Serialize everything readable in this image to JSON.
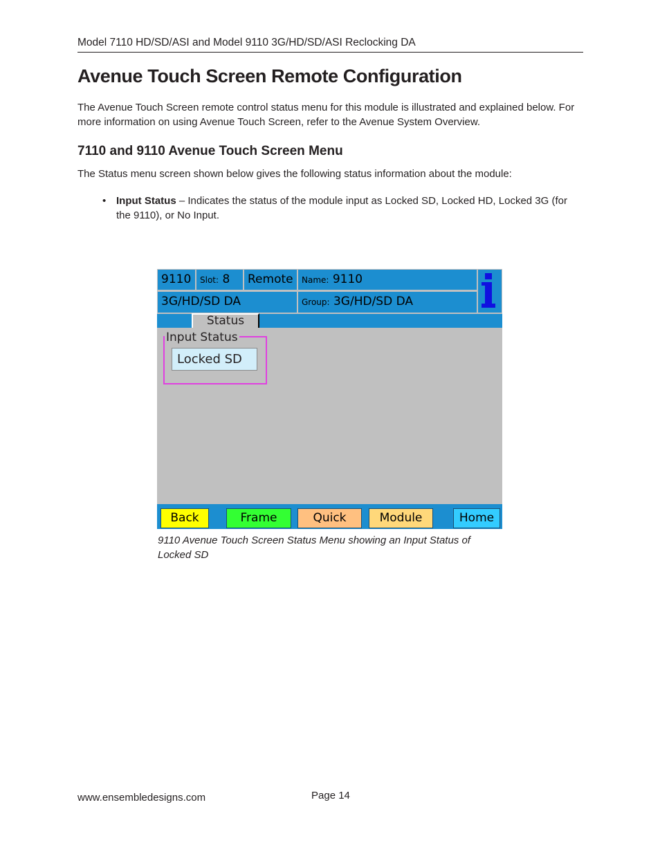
{
  "header": {
    "running_title": "Model 7110 HD/SD/ASI and Model 9110 3G/HD/SD/ASI Reclocking DA"
  },
  "title": "Avenue Touch Screen Remote Configuration",
  "intro": "The Avenue Touch Screen remote control status menu for this module is illustrated and explained below. For more information on using Avenue Touch Screen, refer to the Avenue System Overview.",
  "section": {
    "heading": "7110 and 9110 Avenue Touch Screen Menu",
    "text": "The Status menu screen shown below gives the following status information about the module:",
    "bullets": [
      {
        "term": "Input Status",
        "text": " – Indicates the status of the module input as Locked SD, Locked HD, Locked 3G (for the 9110), or No Input."
      }
    ]
  },
  "screen": {
    "model": "9110",
    "slot_label": "Slot:",
    "slot": "8",
    "mode": "Remote",
    "name_label": "Name:",
    "name": "9110",
    "type": "3G/HD/SD DA",
    "group_label": "Group:",
    "group": "3G/HD/SD DA",
    "info_icon": "info-icon",
    "tab": "Status",
    "input_status_label": "Input Status",
    "input_status_value": "Locked SD",
    "nav": [
      {
        "label": "Back",
        "color": "#ffff00"
      },
      {
        "label": "Frame",
        "color": "#33ff33"
      },
      {
        "label": "Quick",
        "color": "#ffc080"
      },
      {
        "label": "Module",
        "color": "#ffd87a"
      },
      {
        "label": "Home",
        "color": "#33ccff"
      }
    ],
    "accent_color": "#1c8ed0",
    "highlight_color": "#e040e0"
  },
  "caption": "9110 Avenue Touch Screen Status Menu showing an Input Status of Locked SD",
  "footer": {
    "url": "www.ensembledesigns.com",
    "page": "Page 14"
  }
}
